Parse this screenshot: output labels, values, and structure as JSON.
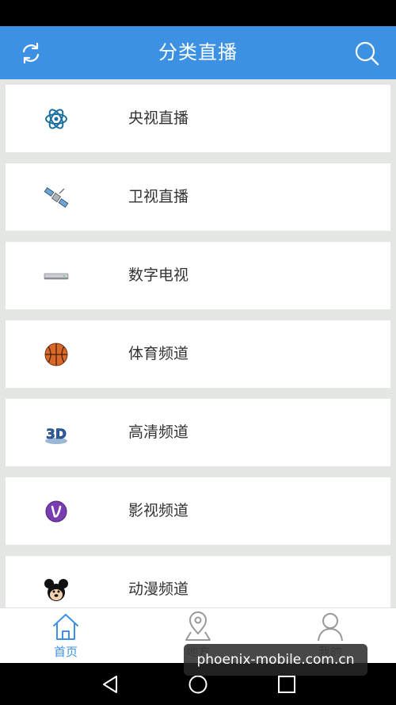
{
  "app_bar": {
    "title": "分类直播",
    "left_icon": "refresh-icon",
    "right_icon": "search-icon",
    "color": "#3d91e3"
  },
  "categories": [
    {
      "label": "央视直播",
      "icon": "atom-icon"
    },
    {
      "label": "卫视直播",
      "icon": "satellite-icon"
    },
    {
      "label": "数字电视",
      "icon": "set-top-box-icon"
    },
    {
      "label": "体育频道",
      "icon": "basketball-icon"
    },
    {
      "label": "高清频道",
      "icon": "3d-icon"
    },
    {
      "label": "影视频道",
      "icon": "film-logo-icon"
    },
    {
      "label": "动漫频道",
      "icon": "mickey-icon"
    }
  ],
  "bottom_nav": {
    "tabs": [
      {
        "label": "首页",
        "icon": "home-icon",
        "active": true
      },
      {
        "label": "地方",
        "icon": "location-pin-icon",
        "active": false
      },
      {
        "label": "我的",
        "icon": "person-icon",
        "active": false
      }
    ]
  },
  "watermark": "phoenix-mobile.com.cn",
  "system_nav": [
    "back-icon",
    "home-circle-icon",
    "recents-icon"
  ]
}
